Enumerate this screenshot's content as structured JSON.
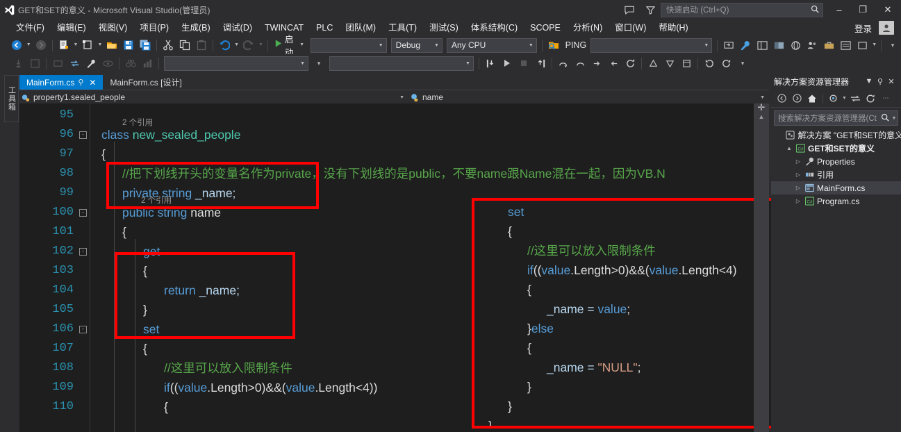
{
  "titlebar": {
    "title": "GET和SET的意义 - Microsoft Visual Studio(管理员)",
    "feedback_icon": "feedback-icon",
    "filter_icon": "filter-icon",
    "quick_launch_placeholder": "快速启动 (Ctrl+Q)",
    "search_icon": "search-icon",
    "minimize": "–",
    "maximize": "❐",
    "close": "✕"
  },
  "menubar": {
    "items": [
      "文件(F)",
      "编辑(E)",
      "视图(V)",
      "项目(P)",
      "生成(B)",
      "调试(D)",
      "TWINCAT",
      "PLC",
      "团队(M)",
      "工具(T)",
      "测试(S)",
      "体系结构(C)",
      "SCOPE",
      "分析(N)",
      "窗口(W)",
      "帮助(H)"
    ],
    "signin_label": "登录",
    "account_icon": "account-icon"
  },
  "toolbar": {
    "row1": {
      "nav_back_icon": "navigate-back-icon",
      "nav_forward_icon": "navigate-forward-icon",
      "new_project_icon": "new-project-icon",
      "new_item_icon": "new-item-icon",
      "open_file_icon": "open-file-icon",
      "save_icon": "save-icon",
      "save_all_icon": "save-all-icon",
      "cut_icon": "cut-icon",
      "copy_icon": "copy-icon",
      "paste_icon": "paste-icon",
      "undo_icon": "undo-icon",
      "redo_icon": "redo-icon",
      "start_icon": "start-play-icon",
      "start_label": "启动",
      "process_value": "",
      "config_value": "Debug",
      "platform_value": "Any CPU",
      "ping_icon": "ping-target-icon",
      "ping_label": "PING"
    },
    "row2": {
      "step_into_icon": "step-into-icon",
      "step_over_icon": "step-over-icon",
      "step_out_icon": "step-out-icon",
      "restart_icon": "restart-icon",
      "breakpoint_icon": "breakpoint-icon",
      "stop_icon": "stop-icon",
      "empty_combo_value": ""
    }
  },
  "left_dock": {
    "toolbox_label": "工具箱"
  },
  "editor": {
    "tabs": [
      {
        "label": "MainForm.cs",
        "active": true,
        "pin_icon": "pin-icon",
        "close_icon": "close-icon"
      },
      {
        "label": "MainForm.cs [设计]",
        "active": false
      }
    ],
    "navbar": {
      "class_value": "property1.sealed_people",
      "class_icon": "class-icon",
      "member_value": "name",
      "member_icon": "property-icon",
      "dropdown_icon": "chevron-down-icon"
    },
    "lines": [
      {
        "num": "95",
        "fold": "",
        "tokens": []
      },
      {
        "num": "96",
        "fold": "-",
        "ref": "2 个引用",
        "tokens": [
          {
            "t": "class ",
            "c": "k"
          },
          {
            "t": "new_sealed_people",
            "c": "t"
          }
        ]
      },
      {
        "num": "97",
        "fold": "",
        "tokens": [
          {
            "t": "{",
            "c": "p"
          }
        ]
      },
      {
        "num": "98",
        "fold": "",
        "indent": 1,
        "tokens": [
          {
            "t": "//把下划线开头的变量名作为private，没有下划线的是public，不要name跟Name混在一起，因为VB.N",
            "c": "c"
          }
        ]
      },
      {
        "num": "99",
        "fold": "",
        "indent": 1,
        "ref2": "2 个引用",
        "tokens": [
          {
            "t": "private ",
            "c": "k"
          },
          {
            "t": "string ",
            "c": "k"
          },
          {
            "t": "_name;",
            "c": "n"
          }
        ]
      },
      {
        "num": "100",
        "fold": "-",
        "indent": 1,
        "tokens": [
          {
            "t": "public ",
            "c": "k"
          },
          {
            "t": "string ",
            "c": "k"
          },
          {
            "t": "name",
            "c": "p"
          }
        ]
      },
      {
        "num": "101",
        "fold": "",
        "indent": 1,
        "tokens": [
          {
            "t": "{",
            "c": "p"
          }
        ]
      },
      {
        "num": "102",
        "fold": "-",
        "indent": 2,
        "tokens": [
          {
            "t": "get",
            "c": "k"
          }
        ]
      },
      {
        "num": "103",
        "fold": "",
        "indent": 2,
        "tokens": [
          {
            "t": "{",
            "c": "p"
          }
        ]
      },
      {
        "num": "104",
        "fold": "",
        "indent": 3,
        "tokens": [
          {
            "t": "return ",
            "c": "k"
          },
          {
            "t": "_name;",
            "c": "n"
          }
        ]
      },
      {
        "num": "105",
        "fold": "",
        "indent": 2,
        "tokens": [
          {
            "t": "}",
            "c": "p"
          }
        ]
      },
      {
        "num": "106",
        "fold": "-",
        "indent": 2,
        "tokens": [
          {
            "t": "set",
            "c": "k"
          }
        ]
      },
      {
        "num": "107",
        "fold": "",
        "indent": 2,
        "tokens": [
          {
            "t": "{",
            "c": "p"
          }
        ]
      },
      {
        "num": "108",
        "fold": "",
        "indent": 3,
        "tokens": [
          {
            "t": "//这里可以放入限制条件",
            "c": "c"
          }
        ]
      },
      {
        "num": "109",
        "fold": "",
        "indent": 3,
        "tokens": [
          {
            "t": "if",
            "c": "k"
          },
          {
            "t": "((",
            "c": "p"
          },
          {
            "t": "value",
            "c": "k"
          },
          {
            "t": ".Length>0)&&(",
            "c": "p"
          },
          {
            "t": "value",
            "c": "k"
          },
          {
            "t": ".Length<4))",
            "c": "p"
          }
        ]
      },
      {
        "num": "110",
        "fold": "",
        "indent": 3,
        "tokens": [
          {
            "t": "{",
            "c": "p"
          }
        ]
      }
    ]
  },
  "overlay_panel": {
    "lines": [
      {
        "indent": 0,
        "tokens": [
          {
            "t": "set",
            "c": "k"
          }
        ]
      },
      {
        "indent": 0,
        "tokens": [
          {
            "t": "{",
            "c": "p"
          }
        ]
      },
      {
        "indent": 1,
        "tokens": [
          {
            "t": "//这里可以放入限制条件",
            "c": "c"
          }
        ]
      },
      {
        "indent": 1,
        "tokens": [
          {
            "t": "if",
            "c": "k"
          },
          {
            "t": "((",
            "c": "p"
          },
          {
            "t": "value",
            "c": "k"
          },
          {
            "t": ".Length>0)&&(",
            "c": "p"
          },
          {
            "t": "value",
            "c": "k"
          },
          {
            "t": ".Length<4)",
            "c": "p"
          }
        ]
      },
      {
        "indent": 1,
        "tokens": [
          {
            "t": "{",
            "c": "p"
          }
        ]
      },
      {
        "indent": 2,
        "tokens": [
          {
            "t": "_name = ",
            "c": "n"
          },
          {
            "t": "value",
            "c": "k"
          },
          {
            "t": ";",
            "c": "p"
          }
        ]
      },
      {
        "indent": 1,
        "tokens": [
          {
            "t": "}",
            "c": "p"
          },
          {
            "t": "else",
            "c": "k"
          }
        ]
      },
      {
        "indent": 1,
        "tokens": [
          {
            "t": "{",
            "c": "p"
          }
        ]
      },
      {
        "indent": 2,
        "tokens": [
          {
            "t": "_name = ",
            "c": "n"
          },
          {
            "t": "\"NULL\"",
            "c": "s"
          },
          {
            "t": ";",
            "c": "p"
          }
        ]
      },
      {
        "indent": 1,
        "tokens": [
          {
            "t": "}",
            "c": "p"
          }
        ]
      },
      {
        "indent": 0,
        "tokens": [
          {
            "t": "}",
            "c": "p"
          }
        ]
      },
      {
        "indent": -1,
        "tokens": [
          {
            "t": "}",
            "c": "p"
          }
        ]
      }
    ]
  },
  "solution_explorer": {
    "title": "解决方案资源管理器",
    "header_buttons": {
      "dropdown_icon": "chevron-down-icon",
      "pin_icon": "pin-icon",
      "close_icon": "close-icon"
    },
    "toolbar_icons": [
      "back-icon",
      "forward-icon",
      "home-icon",
      "pending-changes-icon",
      "sync-icon",
      "refresh-icon",
      "overflow-icon"
    ],
    "search_placeholder": "搜索解决方案资源管理器(Ct",
    "search_icon": "search-icon",
    "tree": [
      {
        "depth": 0,
        "expander": "",
        "icon": "solution-icon",
        "label": "解决方案 \"GET和SET的意义\"",
        "bold": false,
        "selected": false
      },
      {
        "depth": 1,
        "expander": "▲",
        "icon": "csharp-project-icon",
        "label": "GET和SET的意义",
        "bold": true,
        "selected": false
      },
      {
        "depth": 2,
        "expander": "▷",
        "icon": "properties-icon",
        "label": "Properties",
        "bold": false,
        "selected": false
      },
      {
        "depth": 2,
        "expander": "▷",
        "icon": "references-icon",
        "label": "引用",
        "bold": false,
        "selected": false
      },
      {
        "depth": 2,
        "expander": "▷",
        "icon": "form-file-icon",
        "label": "MainForm.cs",
        "bold": false,
        "selected": true
      },
      {
        "depth": 2,
        "expander": "▷",
        "icon": "csharp-file-icon",
        "label": "Program.cs",
        "bold": false,
        "selected": false
      }
    ]
  },
  "scrollbars": {
    "vertical_up_icon": "scroll-up-icon",
    "split_icon": "split-view-icon",
    "horizontal_right_icon": "scroll-right-icon"
  },
  "colors": {
    "accent": "#007acc",
    "chrome": "#2d2d30",
    "editor_bg": "#1e1e1e",
    "annotation": "#ff0000",
    "keyword": "#569cd6",
    "comment": "#57a64a",
    "type": "#4ec9b0",
    "string": "#d69d85",
    "linenum": "#2b91af"
  }
}
